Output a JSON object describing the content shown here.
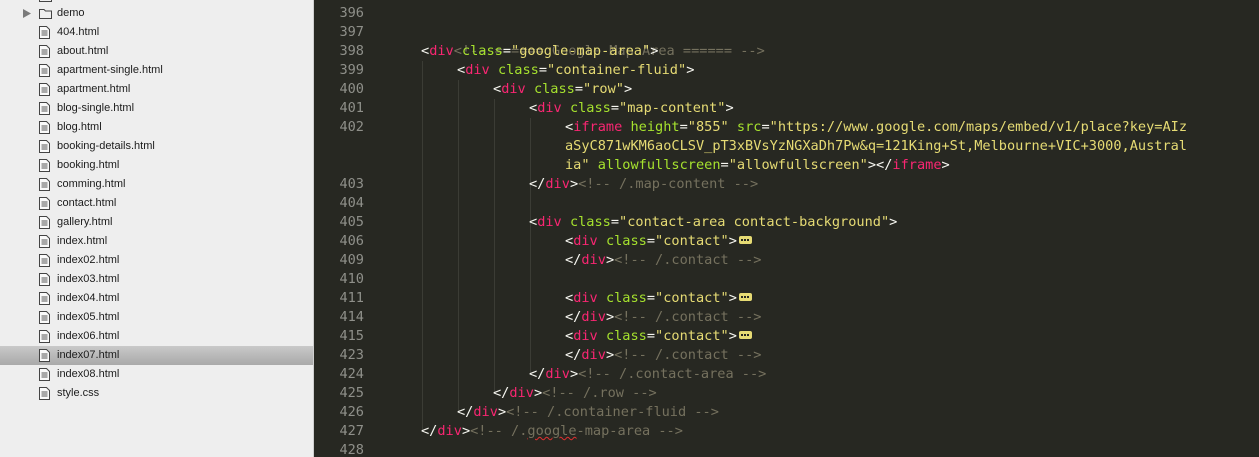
{
  "sidebar": {
    "folder": {
      "label": "demo"
    },
    "files": [
      "404.html",
      "about.html",
      "apartment-single.html",
      "apartment.html",
      "blog-single.html",
      "blog.html",
      "booking-details.html",
      "booking.html",
      "comming.html",
      "contact.html",
      "gallery.html",
      "index.html",
      "index02.html",
      "index03.html",
      "index04.html",
      "index05.html",
      "index06.html",
      "index07.html",
      "index08.html",
      "style.css"
    ],
    "selected_file": "index07.html"
  },
  "editor": {
    "colors": {
      "background": "#272822",
      "tag": "#f92672",
      "attribute": "#a6e22e",
      "string": "#e6db74",
      "comment": "#75715e",
      "line_number": "#8f908a"
    },
    "line_numbers": [
      "396",
      "397",
      "398",
      "399",
      "400",
      "401",
      "402",
      "",
      "",
      "403",
      "404",
      "405",
      "406",
      "409",
      "410",
      "411",
      "414",
      "415",
      "423",
      "424",
      "425",
      "426",
      "427",
      "428"
    ],
    "lines": {
      "l397": {
        "comment": "<!-- ====== Google Map Area ====== -->"
      },
      "l398": {
        "open": "<",
        "tag": "div",
        "attr": "class",
        "eq": "=",
        "val": "\"google-map-area\"",
        "close": ">"
      },
      "l399": {
        "open": "<",
        "tag": "div",
        "attr": "class",
        "eq": "=",
        "val": "\"container-fluid\"",
        "close": ">"
      },
      "l400": {
        "open": "<",
        "tag": "div",
        "attr": "class",
        "eq": "=",
        "val": "\"row\"",
        "close": ">"
      },
      "l401": {
        "open": "<",
        "tag": "div",
        "attr": "class",
        "eq": "=",
        "val": "\"map-content\"",
        "close": ">"
      },
      "l402a": {
        "open": "<",
        "tag": "iframe",
        "attr1": "height",
        "eq1": "=",
        "val1": "\"855\"",
        "attr2": "src",
        "eq2": "=",
        "val2a": "\"https://www.google.com/maps/embed/v1/place?key=AIz"
      },
      "l402b": {
        "val2b": "aSyC871wKM6aoCLSV_pT3xBVsYzNGXaDh7Pw&q=121King+St,Melbourne+VIC+3000,Austral"
      },
      "l402c": {
        "val2c": "ia\"",
        "attr3": "allowfullscreen",
        "eq3": "=",
        "val3": "\"allowfullscreen\"",
        "close": "></",
        "tag_end": "iframe",
        "close2": ">"
      },
      "l403": {
        "open": "</",
        "tag": "div",
        "close": ">",
        "comment": "<!-- /.map-content -->"
      },
      "l405": {
        "open": "<",
        "tag": "div",
        "attr": "class",
        "eq": "=",
        "val": "\"contact-area contact-background\"",
        "close": ">"
      },
      "l406": {
        "open": "<",
        "tag": "div",
        "attr": "class",
        "eq": "=",
        "val": "\"contact\"",
        "close": ">"
      },
      "l409": {
        "open": "</",
        "tag": "div",
        "close": ">",
        "comment": "<!-- /.contact -->"
      },
      "l411": {
        "open": "<",
        "tag": "div",
        "attr": "class",
        "eq": "=",
        "val": "\"contact\"",
        "close": ">"
      },
      "l414": {
        "open": "</",
        "tag": "div",
        "close": ">",
        "comment": "<!-- /.contact -->"
      },
      "l415": {
        "open": "<",
        "tag": "div",
        "attr": "class",
        "eq": "=",
        "val": "\"contact\"",
        "close": ">"
      },
      "l423": {
        "open": "</",
        "tag": "div",
        "close": ">",
        "comment": "<!-- /.contact -->"
      },
      "l424": {
        "open": "</",
        "tag": "div",
        "close": ">",
        "comment": "<!-- /.contact-area -->"
      },
      "l425": {
        "open": "</",
        "tag": "div",
        "close": ">",
        "comment": "<!-- /.row -->"
      },
      "l426": {
        "open": "</",
        "tag": "div",
        "close": ">",
        "comment": "<!-- /.container-fluid -->"
      },
      "l427": {
        "open": "</",
        "tag": "div",
        "close": ">",
        "comment_a": "<!-- /.",
        "comment_b": "google",
        "comment_c": "-map-area -->"
      }
    }
  }
}
